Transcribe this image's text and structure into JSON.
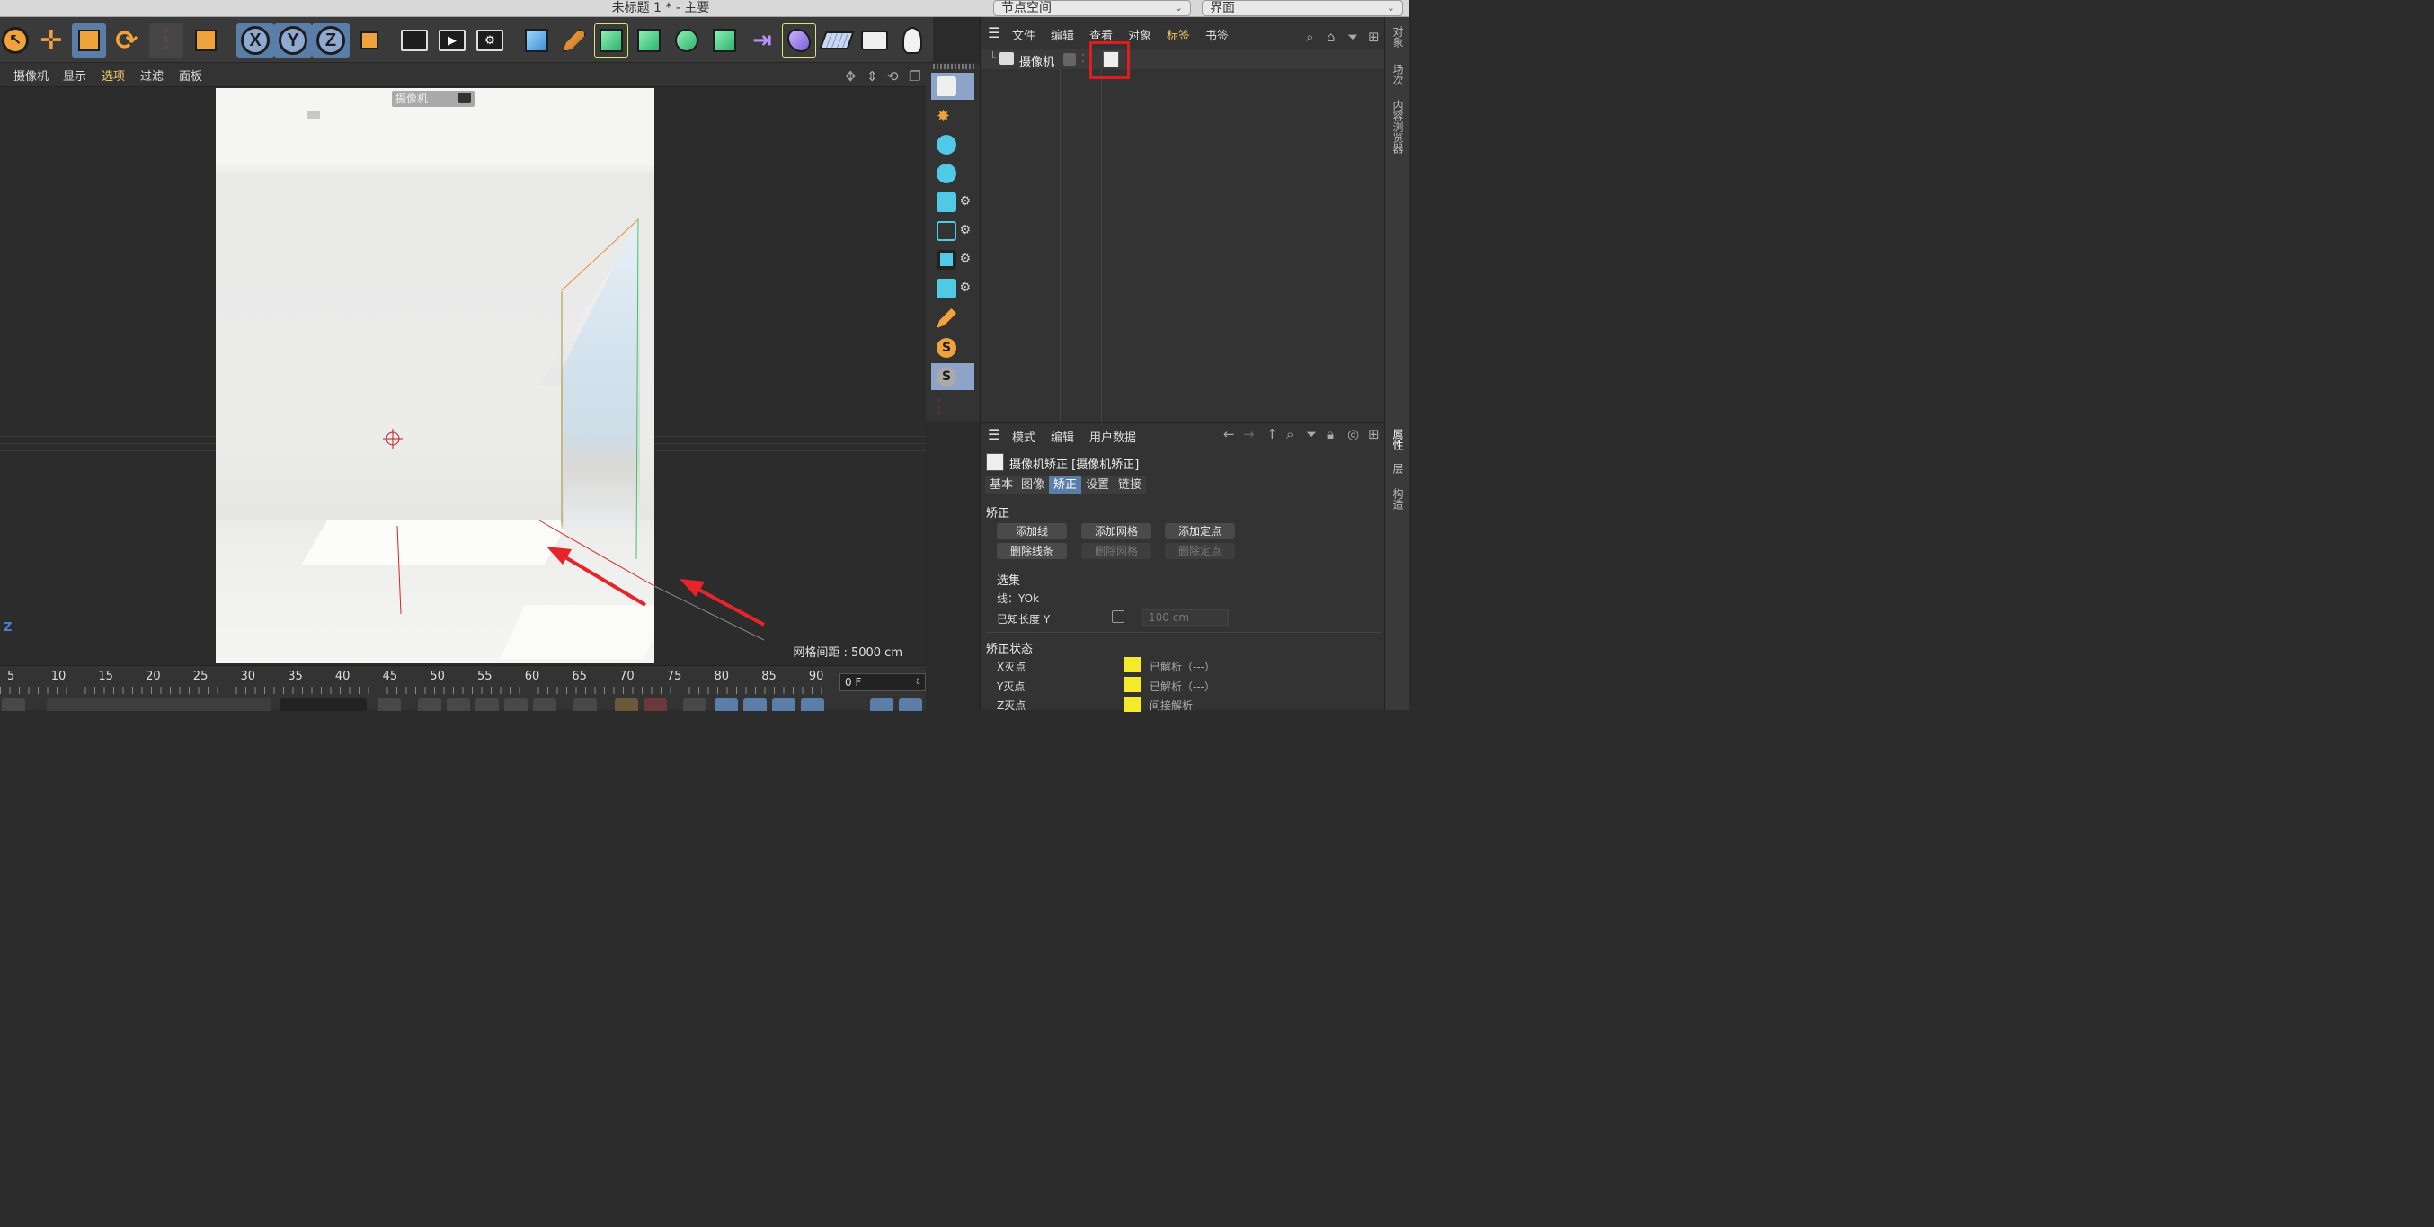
{
  "window": {
    "title": "未标题 1 * - 主要",
    "node_space_label": "节点空间",
    "layout_label": "界面"
  },
  "viewport_menu": [
    "摄像机",
    "显示",
    "选项",
    "过滤",
    "面板"
  ],
  "viewport": {
    "camera_label": "摄像机",
    "grid_info": "网格间距 : 5000 cm",
    "axis_label": "Z"
  },
  "object_manager": {
    "menu": [
      "文件",
      "编辑",
      "查看",
      "对象",
      "标签",
      "书签"
    ],
    "active_menu": "标签",
    "object_name": "摄像机"
  },
  "attribute_manager": {
    "menu": [
      "模式",
      "编辑",
      "用户数据"
    ],
    "title": "摄像机矫正 [摄像机矫正]",
    "tabs": [
      "基本",
      "图像",
      "矫正",
      "设置",
      "链接"
    ],
    "active_tab": "矫正",
    "section_correct": "矫正",
    "buttons": [
      "添加线",
      "添加网格",
      "添加定点",
      "删除线条",
      "删除网格",
      "删除定点"
    ],
    "section_selection": "选集",
    "line_label": "线：YOk",
    "known_length_label": "已知长度 Y",
    "known_length_value": "100 cm",
    "section_status": "矫正状态",
    "status_rows": [
      {
        "label": "X灭点",
        "status": "已解析（---）",
        "color": "#f2ea2a"
      },
      {
        "label": "Y灭点",
        "status": "已解析（---）",
        "color": "#f2ea2a"
      },
      {
        "label": "Z灭点",
        "status": "间接解析",
        "color": "#f2ea2a"
      }
    ]
  },
  "right_edge_tabs": [
    "对象",
    "场次",
    "内容浏览器",
    "属性",
    "层",
    "构造"
  ],
  "timeline": {
    "ticks": [
      "5",
      "10",
      "15",
      "20",
      "25",
      "30",
      "35",
      "40",
      "45",
      "50",
      "55",
      "60",
      "65",
      "70",
      "75",
      "80",
      "85",
      "90"
    ],
    "current_frame": "0 F"
  },
  "colors": {
    "accent": "#5b7ea8",
    "highlight_box": "#e01c1c",
    "annotation_arrow": "#e8242a",
    "menu_active": "#f5c96a"
  }
}
